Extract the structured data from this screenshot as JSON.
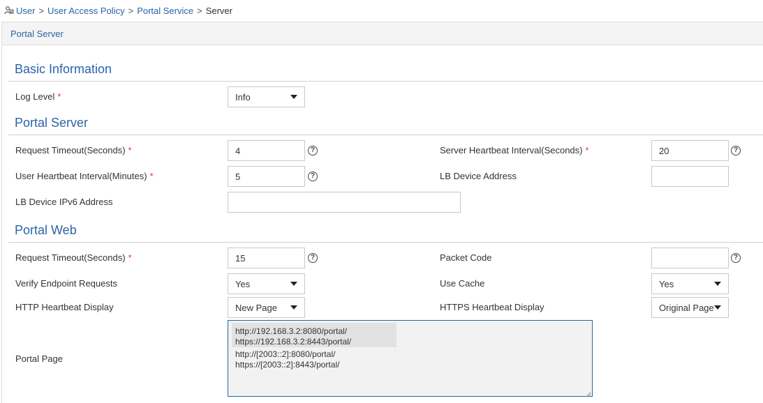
{
  "breadcrumb": {
    "items": [
      "User",
      "User Access Policy",
      "Portal Service"
    ],
    "separator": ">",
    "current": "Server"
  },
  "panel": {
    "title": "Portal Server"
  },
  "sections": {
    "basic": "Basic Information",
    "portal_server": "Portal Server",
    "portal_web": "Portal Web"
  },
  "required_mark": "*",
  "help_glyph": "?",
  "basic": {
    "log_level": {
      "label": "Log Level",
      "value": "Info"
    }
  },
  "portal_server": {
    "request_timeout": {
      "label": "Request Timeout(Seconds)",
      "value": "4"
    },
    "server_heartbeat": {
      "label": "Server Heartbeat Interval(Seconds)",
      "value": "20"
    },
    "user_heartbeat": {
      "label": "User Heartbeat Interval(Minutes)",
      "value": "5"
    },
    "lb_address": {
      "label": "LB Device Address",
      "value": ""
    },
    "lb_ipv6": {
      "label": "LB Device IPv6 Address",
      "value": ""
    }
  },
  "portal_web": {
    "request_timeout": {
      "label": "Request Timeout(Seconds)",
      "value": "15"
    },
    "packet_code": {
      "label": "Packet Code",
      "value": ""
    },
    "verify_endpoint": {
      "label": "Verify Endpoint Requests",
      "value": "Yes"
    },
    "use_cache": {
      "label": "Use Cache",
      "value": "Yes"
    },
    "http_heartbeat": {
      "label": "HTTP Heartbeat Display",
      "value": "New Page"
    },
    "https_heartbeat": {
      "label": "HTTPS Heartbeat Display",
      "value": "Original Page"
    },
    "portal_page": {
      "label": "Portal Page",
      "lines": [
        "http://192.168.3.2:8080/portal/",
        "https://192.168.3.2:8443/portal/",
        "http://[2003::2]:8080/portal/",
        "https://[2003::2]:8443/portal/"
      ]
    }
  },
  "colors": {
    "accent": "#2a64a8",
    "required": "#d9363e",
    "header_bg": "#f4f4f4",
    "textarea_bg": "#f2f2f2",
    "highlight": "#e2e2e2"
  }
}
